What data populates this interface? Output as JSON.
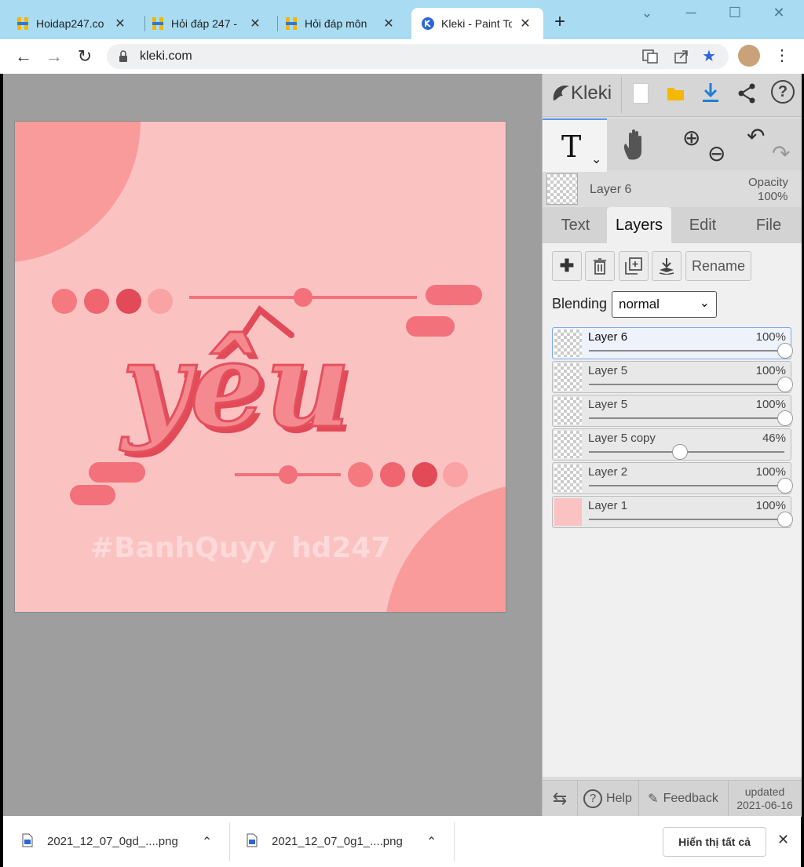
{
  "browser": {
    "tabs": [
      {
        "title": "Hoidap247.co"
      },
      {
        "title": "Hỏi đáp 247 -"
      },
      {
        "title": "Hỏi đáp môn"
      },
      {
        "title": "Kleki - Paint To"
      }
    ],
    "new_tab_label": "+",
    "url": "kleki.com"
  },
  "canvas": {
    "main_word": "yêu",
    "watermark_left": "#BanhQuyy",
    "watermark_right": "hd247"
  },
  "panel": {
    "brand": "Kleki",
    "tool_letter": "T",
    "active_layer_name": "Layer 6",
    "opacity_label": "Opacity",
    "opacity_value": "100%",
    "tabs": [
      {
        "label": "Text"
      },
      {
        "label": "Layers"
      },
      {
        "label": "Edit"
      },
      {
        "label": "File"
      }
    ],
    "rename_label": "Rename",
    "blending_label": "Blending",
    "blending_value": "normal",
    "blending_options": [
      "normal"
    ],
    "layers": [
      {
        "name": "Layer 6",
        "opacity": "100%",
        "level": 1.0
      },
      {
        "name": "Layer 5",
        "opacity": "100%",
        "level": 1.0
      },
      {
        "name": "Layer 5",
        "opacity": "100%",
        "level": 1.0
      },
      {
        "name": "Layer 5 copy",
        "opacity": "46%",
        "level": 0.46
      },
      {
        "name": "Layer 2",
        "opacity": "100%",
        "level": 1.0
      },
      {
        "name": "Layer 1",
        "opacity": "100%",
        "level": 1.0
      }
    ],
    "footer": {
      "help": "Help",
      "feedback": "Feedback",
      "updated_label": "updated",
      "updated_date": "2021-06-16"
    }
  },
  "downloads": {
    "items": [
      {
        "name": "2021_12_07_0gd_....png"
      },
      {
        "name": "2021_12_07_0g1_....png"
      }
    ],
    "show_all": "Hiển thị tất cả"
  },
  "colors": {
    "tabstrip": "#a9dcf2",
    "canvas_bg": "#fbc2c2",
    "accent_pink": "#f26f76",
    "dark_pink": "#e24a58",
    "workspace": "#9e9e9e"
  }
}
